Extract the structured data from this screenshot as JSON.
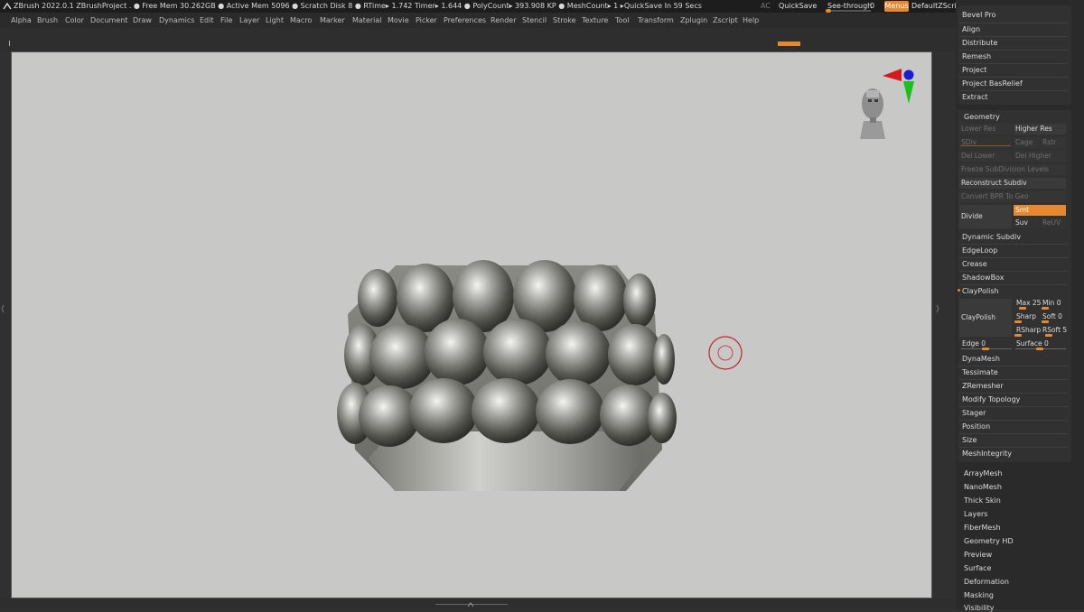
{
  "titlebar": {
    "title": "ZBrush 2022.0.1    ZBrushProject   . ● Free Mem 30.262GB ● Active Mem 5096 ● Scratch Disk 8 ●   RTime▸ 1.742 Timer▸ 1.644 ● PolyCount▸ 393.908 KP   ● MeshCount▸ 1    ▸QuickSave In 59 Secs",
    "ac": "AC",
    "quicksave": "QuickSave",
    "seethrough_label": "See-through",
    "seethrough_value": "0",
    "menus": "Menus",
    "default_script": "DefaultZScript"
  },
  "menu": [
    "Alpha",
    "Brush",
    "Color",
    "Document",
    "Draw",
    "Dynamics",
    "Edit",
    "File",
    "Layer",
    "Light",
    "Macro",
    "Marker",
    "Material",
    "Movie",
    "Picker",
    "Preferences",
    "Render",
    "Stencil",
    "Stroke",
    "Texture",
    "Tool",
    "Transform",
    "Zplugin",
    "Zscript",
    "Help"
  ],
  "top_panel": [
    "Bevel Pro",
    "Align",
    "Distribute",
    "Remesh",
    "Project",
    "Project BasRelief",
    "Extract"
  ],
  "geometry": {
    "header": "Geometry",
    "lower_res": "Lower Res",
    "higher_res": "Higher Res",
    "sdiv": "SDiv",
    "cage": "Cage",
    "rstr": "Rstr",
    "del_lower": "Del Lower",
    "del_higher": "Del Higher",
    "freeze": "Freeze SubDivision Levels",
    "reconstruct": "Reconstruct Subdiv",
    "convert_bpr": "Convert BPR To Geo",
    "divide": "Divide",
    "smt": "Smt",
    "suv": "Suv",
    "reuv": "ReUV",
    "items_a": [
      "Dynamic Subdiv",
      "EdgeLoop",
      "Crease",
      "ShadowBox"
    ],
    "claypolish_header": "ClayPolish",
    "claypolish_btn": "ClayPolish",
    "max": "Max 25",
    "min": "Min 0",
    "sharp": "Sharp",
    "soft": "Soft 0",
    "rsharp": "RSharp",
    "rsoft": "RSoft 5",
    "edge": "Edge 0",
    "surface": "Surface 0",
    "items_b": [
      "DynaMesh",
      "Tessimate",
      "ZRemesher",
      "Modify Topology",
      "Stager",
      "Position",
      "Size",
      "MeshIntegrity"
    ]
  },
  "lower_list": [
    "ArrayMesh",
    "NanoMesh",
    "Thick Skin",
    "Layers",
    "FiberMesh",
    "Geometry HD",
    "Preview",
    "Surface",
    "Deformation",
    "Masking",
    "Visibility"
  ],
  "colors": {
    "accent": "#e6882d",
    "canvas": "#c8c8c6"
  }
}
